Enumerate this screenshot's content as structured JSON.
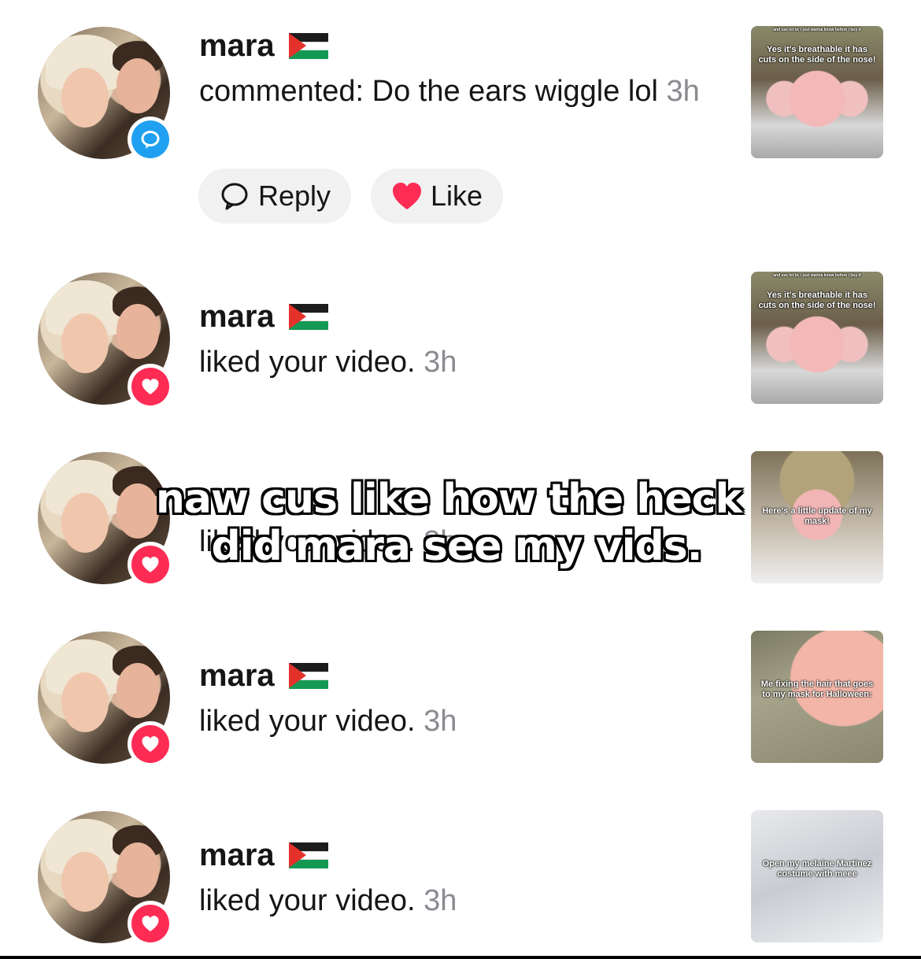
{
  "notifications": [
    {
      "name": "mara",
      "flag_icon": "palestine-flag-icon",
      "badge_icon": "comment-bubble-icon",
      "badge_color": "#20a0f0",
      "text": "commented: Do the ears wiggle lol",
      "time": "3h",
      "thumb_caption_small": "and see lol bc i just wanna know before i buy it",
      "thumb_caption": "Yes it's breathable it has cuts on the side of the nose!",
      "actions": {
        "reply_label": "Reply",
        "like_label": "Like"
      }
    },
    {
      "name": "mara",
      "flag_icon": "palestine-flag-icon",
      "badge_icon": "heart-icon",
      "badge_color": "#fe2c55",
      "text": "liked your video.",
      "time": "3h",
      "thumb_caption_small": "and see lol bc i just wanna know before i buy it",
      "thumb_caption": "Yes it's breathable it has cuts on the side of the nose!"
    },
    {
      "name": "mara",
      "flag_icon": "palestine-flag-icon",
      "badge_icon": "heart-icon",
      "badge_color": "#fe2c55",
      "text": "liked your video.",
      "time": "3h",
      "thumb_caption": "Here's a little update of my mask!"
    },
    {
      "name": "mara",
      "flag_icon": "palestine-flag-icon",
      "badge_icon": "heart-icon",
      "badge_color": "#fe2c55",
      "text": "liked your video.",
      "time": "3h",
      "thumb_caption": "Me fixing the hair that goes to my mask for Halloween:"
    },
    {
      "name": "mara",
      "flag_icon": "palestine-flag-icon",
      "badge_icon": "heart-icon",
      "badge_color": "#fe2c55",
      "text": "liked your video.",
      "time": "3h",
      "thumb_caption": "Open my melaine Martinez costume with meee"
    }
  ],
  "overlay_caption": {
    "line1": "naw cus like how the heck",
    "line2": "did mara see my vids."
  }
}
